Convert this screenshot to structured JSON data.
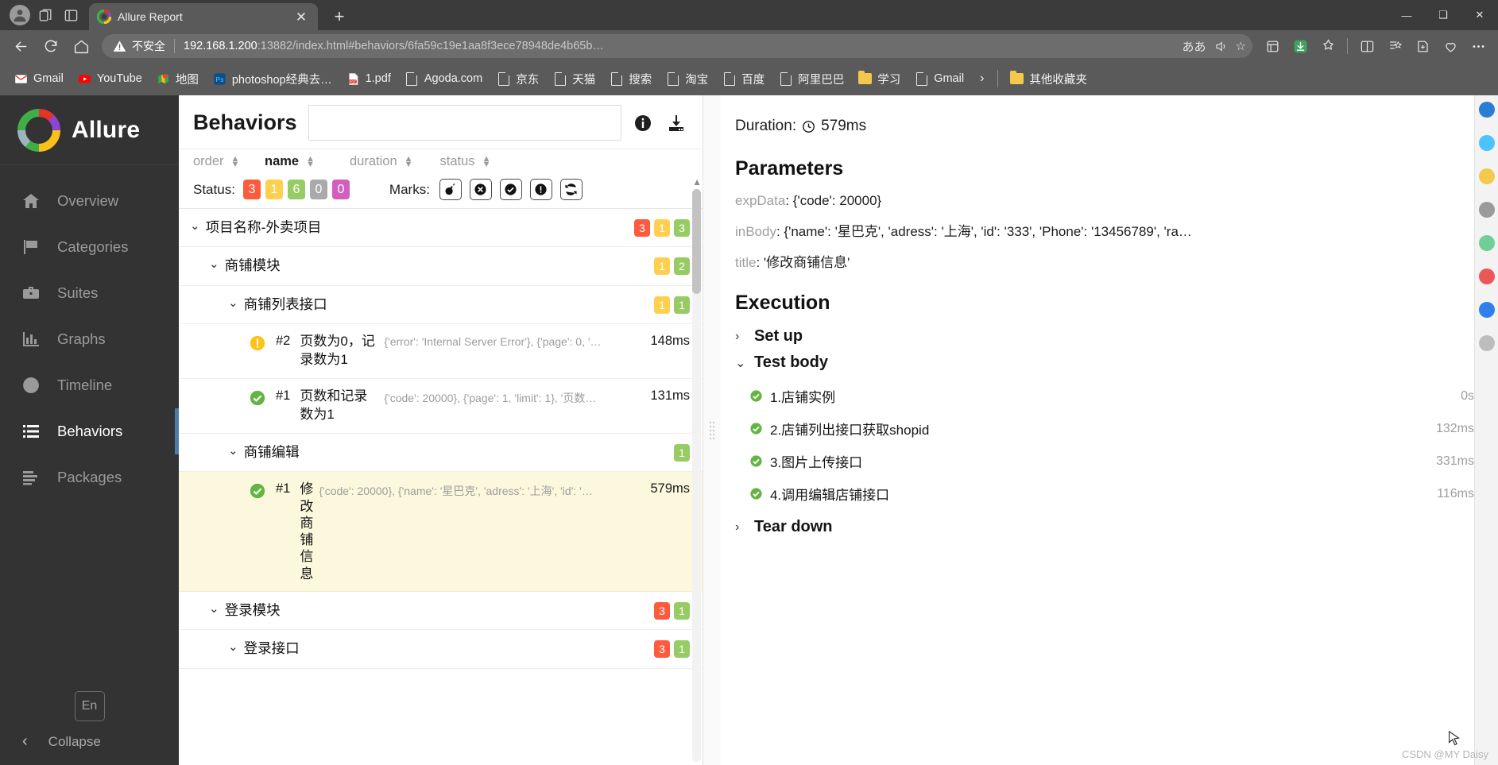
{
  "browser": {
    "tab": {
      "title": "Allure Report",
      "close_label": "✕",
      "favicon": "allure-logo"
    },
    "new_tab_label": "+",
    "window_controls": {
      "minimize": "—",
      "maximize": "❑",
      "close": "✕"
    },
    "nav": {
      "back": "←",
      "reload": "⟳",
      "home": "⌂"
    },
    "omnibox": {
      "security_label": "不安全",
      "url_host": "192.168.1.200",
      "url_rest": ":13882/index.html#behaviors/6fa59c19e1aa8f3ece78948de4b65b…",
      "translate_icon": "ああ",
      "read_aloud_icon": "read-aloud",
      "favorite_icon": "☆"
    },
    "toolbar_icons": [
      "collections-icon",
      "downloads-icon",
      "extensions-icon",
      "split-screen-icon",
      "favorites-icon",
      "add-favorite-icon",
      "browser-essentials-icon",
      "settings-more-icon"
    ],
    "bookmarks": [
      {
        "label": "Gmail",
        "icon": "gmail-icon"
      },
      {
        "label": "YouTube",
        "icon": "youtube-icon"
      },
      {
        "label": "地图",
        "icon": "maps-icon"
      },
      {
        "label": "photoshop经典去…",
        "icon": "photoshop-icon"
      },
      {
        "label": "1.pdf",
        "icon": "pdf-icon"
      },
      {
        "label": "Agoda.com",
        "icon": "doc-icon"
      },
      {
        "label": "京东",
        "icon": "doc-icon"
      },
      {
        "label": "天猫",
        "icon": "doc-icon"
      },
      {
        "label": "搜索",
        "icon": "doc-icon"
      },
      {
        "label": "淘宝",
        "icon": "doc-icon"
      },
      {
        "label": "百度",
        "icon": "doc-icon"
      },
      {
        "label": "阿里巴巴",
        "icon": "doc-icon"
      },
      {
        "label": "学习",
        "icon": "folder-icon"
      },
      {
        "label": "Gmail",
        "icon": "doc-icon"
      }
    ],
    "bookmarks_overflow": "›",
    "other_favorites": {
      "label": "其他收藏夹",
      "icon": "folder-icon"
    }
  },
  "sidebar": {
    "brand": "Allure",
    "items": [
      {
        "label": "Overview",
        "icon": "home-icon",
        "active": false
      },
      {
        "label": "Categories",
        "icon": "flag-icon",
        "active": false
      },
      {
        "label": "Suites",
        "icon": "briefcase-icon",
        "active": false
      },
      {
        "label": "Graphs",
        "icon": "bar-chart-icon",
        "active": false
      },
      {
        "label": "Timeline",
        "icon": "clock-icon",
        "active": false
      },
      {
        "label": "Behaviors",
        "icon": "list-icon",
        "active": true
      },
      {
        "label": "Packages",
        "icon": "packages-icon",
        "active": false
      }
    ],
    "language_label": "En",
    "collapse_label": "Collapse",
    "collapse_chevron": "‹"
  },
  "left_panel": {
    "title": "Behaviors",
    "search_value": "",
    "search_placeholder": "",
    "info_icon": "info-icon",
    "download_icon": "download-icon",
    "sort_columns": [
      {
        "label": "order",
        "active": false
      },
      {
        "label": "name",
        "active": true
      },
      {
        "label": "duration",
        "active": false
      },
      {
        "label": "status",
        "active": false
      }
    ],
    "status_label": "Status:",
    "status_pills": [
      {
        "value": "3",
        "color": "#fd5a3e"
      },
      {
        "value": "1",
        "color": "#ffd050"
      },
      {
        "value": "6",
        "color": "#97cc64"
      },
      {
        "value": "0",
        "color": "#aaaaaa"
      },
      {
        "value": "0",
        "color": "#d35ebe"
      }
    ],
    "marks_label": "Marks:",
    "marks": [
      "flaky-bomb-icon",
      "failed-x-icon",
      "passed-check-icon",
      "broken-exclaim-icon",
      "retry-icon"
    ],
    "tree": [
      {
        "level": 0,
        "chevron": "⌄",
        "name": "项目名称-外卖项目",
        "counts": [
          {
            "value": "3",
            "color": "#fd5a3e"
          },
          {
            "value": "1",
            "color": "#ffd050"
          },
          {
            "value": "3",
            "color": "#97cc64"
          }
        ]
      },
      {
        "level": 1,
        "chevron": "⌄",
        "name": "商铺模块",
        "counts": [
          {
            "value": "1",
            "color": "#ffd050"
          },
          {
            "value": "2",
            "color": "#97cc64"
          }
        ]
      },
      {
        "level": 2,
        "chevron": "⌄",
        "name": "商铺列表接口",
        "counts": [
          {
            "value": "1",
            "color": "#ffd050"
          },
          {
            "value": "1",
            "color": "#97cc64"
          }
        ]
      }
    ],
    "tests": [
      {
        "status": "broken",
        "number": "#2",
        "name": "页数为0，记录数为1",
        "description": "{'error': 'Internal Server Error'}, {'page': 0, '…",
        "duration": "148ms",
        "highlight": false
      },
      {
        "status": "passed",
        "number": "#1",
        "name": "页数和记录数为1",
        "description": "{'code': 20000}, {'page': 1, 'limit': 1}, '页数…",
        "duration": "131ms",
        "highlight": false
      }
    ],
    "tree2": [
      {
        "level": 2,
        "chevron": "⌄",
        "name": "商铺编辑",
        "counts": [
          {
            "value": "1",
            "color": "#97cc64"
          }
        ]
      }
    ],
    "tests2": [
      {
        "status": "passed",
        "number": "#1",
        "name": "修改商铺信息",
        "description": "{'code': 20000}, {'name': '星巴克', 'adress': '上海', 'id': '…",
        "duration": "579ms",
        "highlight": true
      }
    ],
    "tree3": [
      {
        "level": 1,
        "chevron": "⌄",
        "name": "登录模块",
        "counts": [
          {
            "value": "3",
            "color": "#fd5a3e"
          },
          {
            "value": "1",
            "color": "#97cc64"
          }
        ]
      },
      {
        "level": 2,
        "chevron": "⌄",
        "name": "登录接口",
        "counts": [
          {
            "value": "3",
            "color": "#fd5a3e"
          },
          {
            "value": "1",
            "color": "#97cc64"
          }
        ]
      }
    ]
  },
  "right_panel": {
    "duration_label": "Duration:",
    "duration_value": "579ms",
    "parameters_heading": "Parameters",
    "parameters": [
      {
        "key": "expData",
        "value": ": {'code': 20000}"
      },
      {
        "key": "inBody",
        "value": ": {'name': '星巴克', 'adress': '上海', 'id': '333', 'Phone': '13456789', 'ra…"
      },
      {
        "key": "title",
        "value": ": '修改商铺信息'"
      }
    ],
    "execution_heading": "Execution",
    "sections": [
      {
        "label": "Set up",
        "chevron": "›",
        "expanded": false
      },
      {
        "label": "Test body",
        "chevron": "⌄",
        "expanded": true
      },
      {
        "label": "Tear down",
        "chevron": "›",
        "expanded": false
      }
    ],
    "steps": [
      {
        "name": "1.店铺实例",
        "duration": "0s",
        "status": "passed"
      },
      {
        "name": "2.店铺列出接口获取shopid",
        "duration": "132ms",
        "status": "passed"
      },
      {
        "name": "3.图片上传接口",
        "duration": "331ms",
        "status": "passed"
      },
      {
        "name": "4.调用编辑店铺接口",
        "duration": "116ms",
        "status": "passed"
      }
    ]
  },
  "watermark": "CSDN @MY Daisy"
}
